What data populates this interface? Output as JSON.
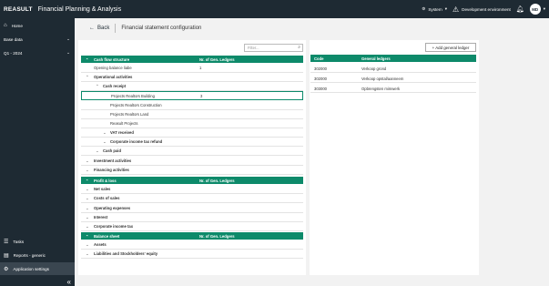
{
  "topbar": {
    "brand": "REASULT",
    "app_title": "Financial Planning & Analysis",
    "system_label": "System",
    "environment_label": "Development environment",
    "user_initials": "MD"
  },
  "sidebar": {
    "home": "Home",
    "base_data": "Base data",
    "period": "Q1 - 2024",
    "tasks": "Tasks",
    "reports": "Reports - generic",
    "app_settings": "Application settings"
  },
  "header": {
    "back_label": "Back",
    "title": "Financial statement configuration"
  },
  "filter": {
    "placeholder": "Filter..."
  },
  "add_button": "+ Add general ledger",
  "cash_flow": {
    "header": "Cash flow structure",
    "col2": "Nr. of Gen. Ledgers",
    "rows": {
      "opening": "Opening balance liabe",
      "opening_val": "1",
      "operational": "Operational activities",
      "cash_receipt": "Cash receipt",
      "p_building": "Projects Realtors Building",
      "p_building_val": "3",
      "p_construction": "Projects Realtors Construction",
      "p_land": "Projects Realtors Land",
      "reasult_projects": "Reasult Projects",
      "vat": "VAT received",
      "corp_refund": "Corporate income tax refund",
      "cash_paid": "Cash paid",
      "investment": "Investment activities",
      "financing": "Financing activities"
    }
  },
  "profit_loss": {
    "header": "Profit & loss",
    "col2": "Nr. of Gen. Ledgers",
    "rows": {
      "net_sales": "Net sales",
      "costs_sales": "Costs of sales",
      "opex": "Operating expenses",
      "interest": "Interest",
      "corp_tax": "Corporate income tax"
    }
  },
  "balance": {
    "header": "Balance sheet",
    "col2": "Nr. of Gen. Ledgers",
    "rows": {
      "assets": "Assets",
      "liabilities": "Liabilities and Stockholders' equity"
    }
  },
  "ledgers": {
    "col_code": "Code",
    "col_name": "General ledgers",
    "rows": [
      {
        "code": "302000",
        "name": "Verkoop grond"
      },
      {
        "code": "302000",
        "name": "Verkoop opstal/aanneem"
      },
      {
        "code": "303000",
        "name": "Opbrengsten mimwerk"
      }
    ]
  }
}
